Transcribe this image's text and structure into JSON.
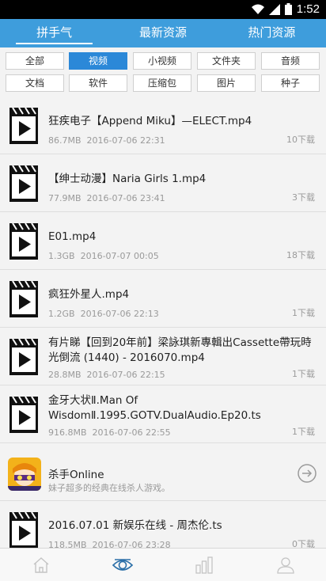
{
  "status": {
    "time": "1:52",
    "wifi_icon": "wifi-icon",
    "signal_icon": "signal-icon",
    "battery_icon": "battery-icon"
  },
  "tabs": [
    {
      "label": "拼手气",
      "active": true
    },
    {
      "label": "最新资源",
      "active": false
    },
    {
      "label": "热门资源",
      "active": false
    }
  ],
  "filters": [
    {
      "label": "全部",
      "active": false
    },
    {
      "label": "视频",
      "active": true
    },
    {
      "label": "小视频",
      "active": false
    },
    {
      "label": "文件夹",
      "active": false
    },
    {
      "label": "音频",
      "active": false
    },
    {
      "label": "文档",
      "active": false
    },
    {
      "label": "软件",
      "active": false
    },
    {
      "label": "压缩包",
      "active": false
    },
    {
      "label": "图片",
      "active": false
    },
    {
      "label": "种子",
      "active": false
    }
  ],
  "items": [
    {
      "title": "狂疾电子【Append Miku】—ELECT.mp4",
      "size": "86.7MB",
      "date": "2016-07-06 22:31",
      "downloads": "10下载"
    },
    {
      "title": "【绅士动漫】Naria Girls 1.mp4",
      "size": "77.9MB",
      "date": "2016-07-06 23:41",
      "downloads": "3下载"
    },
    {
      "title": "E01.mp4",
      "size": "1.3GB",
      "date": "2016-07-07 00:05",
      "downloads": "18下载"
    },
    {
      "title": "疯狂外星人.mp4",
      "size": "1.2GB",
      "date": "2016-07-06 22:13",
      "downloads": "1下载"
    },
    {
      "title": "有片睇【回到20年前】梁詠琪新專輯出Cassette帶玩時光倒流 (1440) - 2016070.mp4",
      "size": "28.8MB",
      "date": "2016-07-06 22:15",
      "downloads": "1下载"
    },
    {
      "title": "金牙大状Ⅱ.Man Of WisdomⅡ.1995.GOTV.DualAudio.Ep20.ts",
      "size": "916.8MB",
      "date": "2016-07-06 22:55",
      "downloads": "1下载"
    }
  ],
  "ad": {
    "title": "杀手Online",
    "desc": "妹子超多的经典在线杀人游戏。",
    "arrow_icon": "arrow-right-circle-icon"
  },
  "last_item": {
    "title": "2016.07.01 新娱乐在线 - 周杰伦.ts",
    "size": "118.5MB",
    "date": "2016-07-06 23:28",
    "downloads": "0下载"
  },
  "nav": [
    {
      "icon": "home-icon",
      "active": false
    },
    {
      "icon": "eye-icon",
      "active": true
    },
    {
      "icon": "chart-icon",
      "active": false
    },
    {
      "icon": "user-icon",
      "active": false
    }
  ],
  "colors": {
    "accent": "#3e9ddc",
    "chip_active": "#2b88d8",
    "nav_active": "#2b6fa8"
  }
}
